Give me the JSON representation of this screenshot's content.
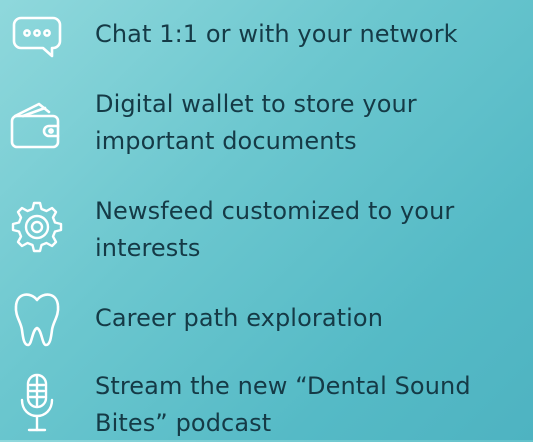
{
  "features": [
    {
      "icon": "chat-bubble-icon",
      "lines": [
        "Chat 1:1 or with your network"
      ]
    },
    {
      "icon": "wallet-icon",
      "lines": [
        "Digital wallet to store your",
        "important documents"
      ]
    },
    {
      "icon": "gear-icon",
      "lines": [
        "Newsfeed customized to your",
        "interests"
      ]
    },
    {
      "icon": "tooth-icon",
      "lines": [
        "Career path exploration"
      ]
    },
    {
      "icon": "microphone-icon",
      "lines": [
        "Stream the new “Dental Sound",
        "Bites” podcast"
      ]
    }
  ],
  "colors": {
    "background_start": "#8fd8dc",
    "background_end": "#4eb3c1",
    "text": "#153a46",
    "icon": "#ffffff"
  }
}
